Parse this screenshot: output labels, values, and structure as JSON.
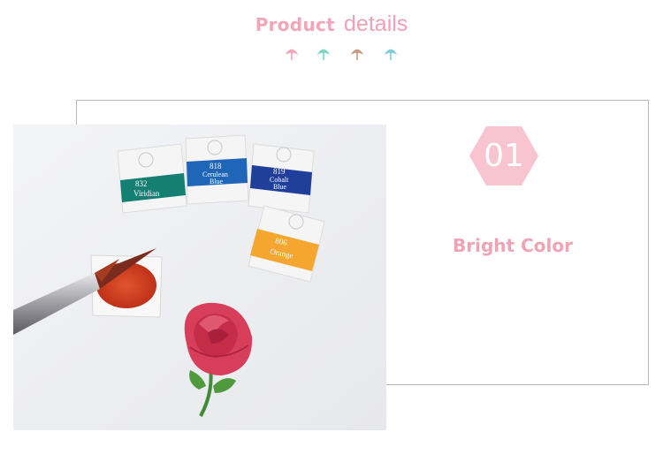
{
  "header": {
    "title_bold": "Product",
    "title_light": "details",
    "dot_colors": [
      "#f1a4b1",
      "#79d7c4",
      "#c99a7e",
      "#7ccdd4"
    ]
  },
  "feature": {
    "number": "01",
    "title": "Bright Color",
    "accent_color": "#f8c4cf"
  },
  "photo": {
    "pans": [
      {
        "number": "832",
        "name": "Viridian",
        "color": "#157f73"
      },
      {
        "number": "818",
        "name": "Cerulean Blue",
        "name_lines": [
          "Cerulean",
          "Blue"
        ],
        "color": "#1f66b8"
      },
      {
        "number": "819",
        "name": "Cobalt Blue",
        "name_lines": [
          "Cobalt",
          "Blue"
        ],
        "color": "#1f3f9a"
      },
      {
        "number": "806",
        "name": "Orange",
        "color": "#f4a62e"
      }
    ]
  }
}
